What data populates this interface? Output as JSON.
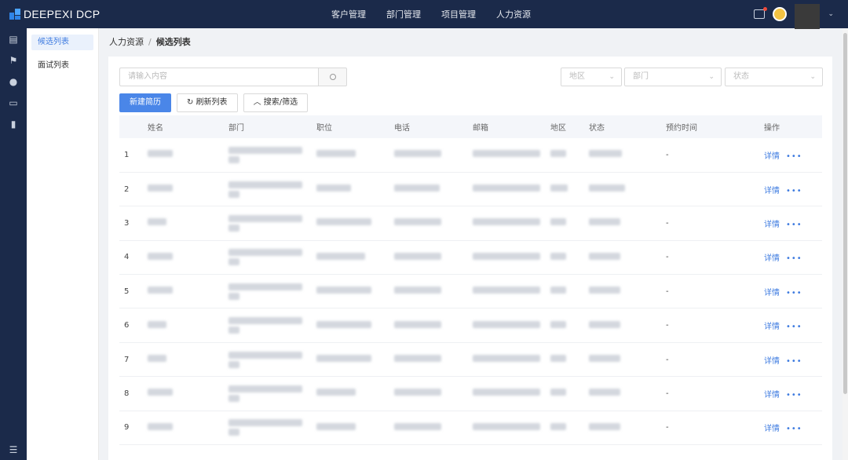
{
  "app": {
    "title": "DEEPEXI DCP"
  },
  "topnav": [
    {
      "label": "客户管理"
    },
    {
      "label": "部门管理"
    },
    {
      "label": "项目管理"
    },
    {
      "label": "人力资源"
    }
  ],
  "user": {
    "menu_caret": "⌄"
  },
  "sidebar_icons": [
    "document-icon",
    "flag-icon",
    "person-icon",
    "archive-icon",
    "trash-icon"
  ],
  "subnav": [
    {
      "label": "候选列表",
      "active": true
    },
    {
      "label": "面试列表",
      "active": false
    }
  ],
  "breadcrumb": {
    "root": "人力资源",
    "sep": "/",
    "current": "候选列表"
  },
  "search": {
    "placeholder": "请输入内容"
  },
  "filters": {
    "region": "地区",
    "department": "部门",
    "status": "状态"
  },
  "buttons": {
    "new": "新建简历",
    "refresh": "刷新列表",
    "search_filter": "搜索/筛选"
  },
  "table": {
    "headers": [
      "",
      "姓名",
      "部门",
      "职位",
      "电话",
      "邮箱",
      "地区",
      "状态",
      "预约时间",
      "操作"
    ],
    "rows": [
      {
        "idx": "1",
        "time": "-",
        "detail": "详情",
        "more": "•••"
      },
      {
        "idx": "2",
        "time": "",
        "detail": "详情",
        "more": "•••"
      },
      {
        "idx": "3",
        "time": "-",
        "detail": "详情",
        "more": "•••"
      },
      {
        "idx": "4",
        "time": "-",
        "detail": "详情",
        "more": "•••"
      },
      {
        "idx": "5",
        "time": "-",
        "detail": "详情",
        "more": "•••"
      },
      {
        "idx": "6",
        "time": "-",
        "detail": "详情",
        "more": "•••"
      },
      {
        "idx": "7",
        "time": "-",
        "detail": "详情",
        "more": "•••"
      },
      {
        "idx": "8",
        "time": "-",
        "detail": "详情",
        "more": "•••"
      },
      {
        "idx": "9",
        "time": "-",
        "detail": "详情",
        "more": "•••"
      }
    ]
  },
  "colors": {
    "topbar": "#1b2a4a",
    "accent": "#4a86e8"
  }
}
